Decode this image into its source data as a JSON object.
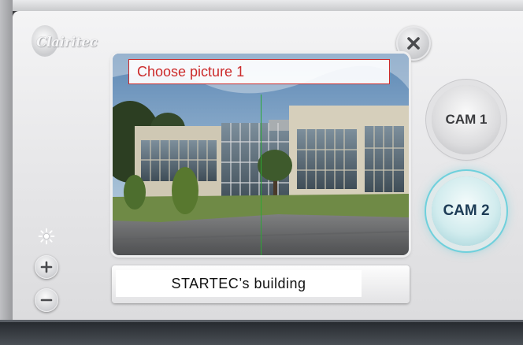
{
  "brand": {
    "logo_text": "Clairitec"
  },
  "prompt": {
    "text": "Choose picture 1"
  },
  "caption": {
    "text": "STARTEC’s building"
  },
  "cameras": [
    {
      "label": "CAM 1",
      "state": "inactive"
    },
    {
      "label": "CAM 2",
      "state": "active"
    }
  ],
  "icons": {
    "close": "close-icon",
    "brightness": "brightness-icon",
    "increase": "plus-icon",
    "decrease": "minus-icon"
  },
  "colors": {
    "prompt_red": "#cc2b2b",
    "active_glow": "#6fd0dc",
    "cursor_line": "#2aa834"
  }
}
